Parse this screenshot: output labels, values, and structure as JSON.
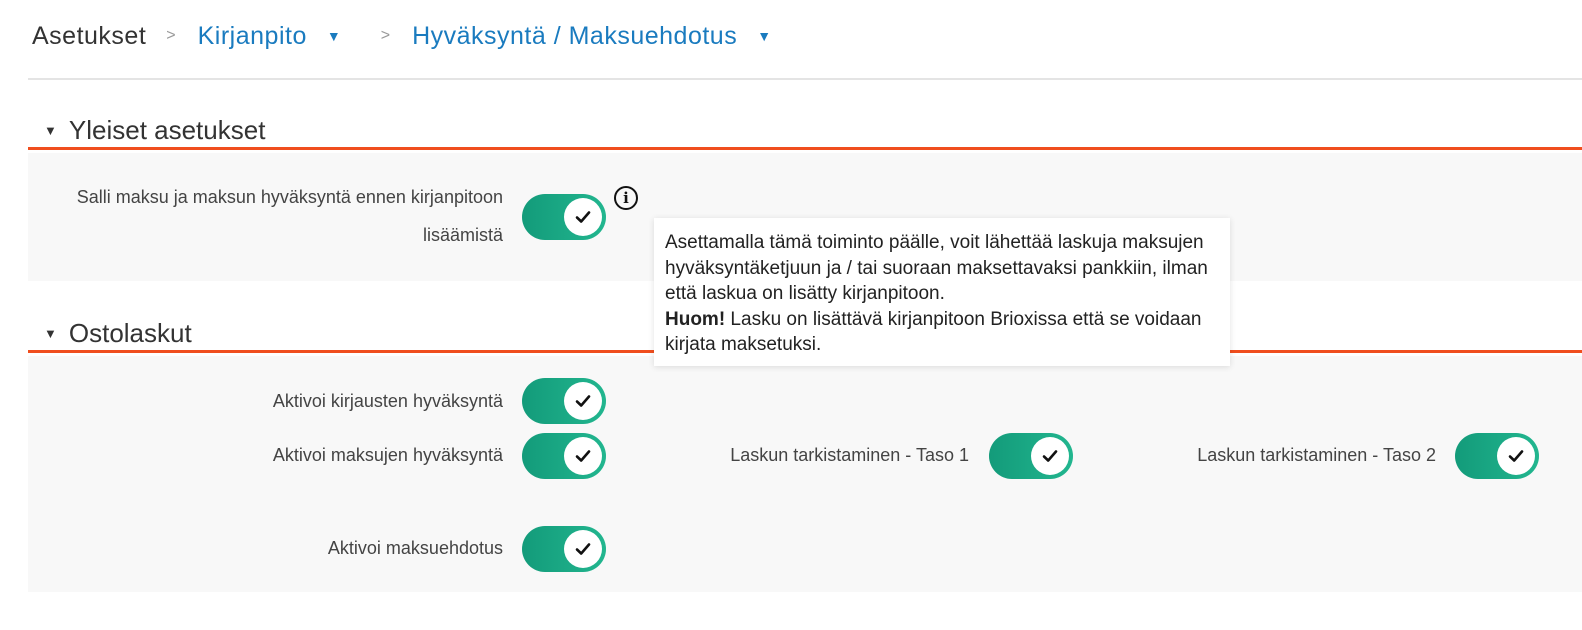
{
  "breadcrumb": {
    "root": "Asetukset",
    "separator": ">",
    "items": [
      {
        "label": "Kirjanpito",
        "caret": "▼"
      },
      {
        "label": "Hyväksyntä / Maksuehdotus",
        "caret": "▼"
      }
    ]
  },
  "sections": {
    "general": {
      "caret": "▼",
      "title": "Yleiset asetukset",
      "setting": {
        "label_line1": "Salli maksu ja maksun hyväksyntä ennen kirjanpitoon",
        "label_line2": "lisäämistä",
        "enabled": true
      },
      "info_icon": "i"
    },
    "purchase_invoices": {
      "caret": "▼",
      "title": "Ostolaskut",
      "settings": {
        "entry_approval": {
          "label": "Aktivoi kirjausten hyväksyntä",
          "enabled": true
        },
        "payment_approval": {
          "label": "Aktivoi maksujen hyväksyntä",
          "enabled": true
        },
        "check_level1": {
          "label": "Laskun tarkistaminen - Taso 1",
          "enabled": true
        },
        "check_level2": {
          "label": "Laskun tarkistaminen - Taso 2",
          "enabled": true
        },
        "payment_proposal": {
          "label": "Aktivoi maksuehdotus",
          "enabled": true
        }
      }
    }
  },
  "tooltip": {
    "text": "Asettamalla tämä toiminto päälle, voit lähettää laskuja maksujen hyväksyntäketjuun ja / tai suoraan maksettavaksi pankkiin, ilman että laskua on lisätty kirjanpitoon.",
    "note_bold": "Huom!",
    "note": " Lasku on lisättävä kirjanpitoon Brioxissa että se voidaan kirjata maksetuksi."
  },
  "colors": {
    "accent": "#f04e1e",
    "link": "#1a7bbf",
    "switch_on": "#139b7a"
  }
}
